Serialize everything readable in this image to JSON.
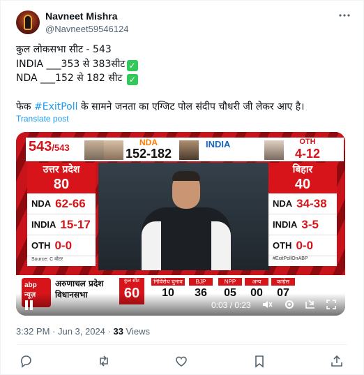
{
  "author": {
    "name": "Navneet Mishra",
    "handle": "@Navneet59546124"
  },
  "tweet": {
    "lines": [
      "कुल लोकसभा सीट - 543",
      "INDIA ___353 से 383सीट",
      "NDA ___152 से 182 सीट"
    ],
    "body_prefix": "फेक ",
    "hashtag": "#ExitPoll",
    "body_suffix": " के सामने जनता का एग्जिट पोल संदीप चौधरी जी लेकर आए है।",
    "check_symbol": "✓",
    "translate_label": "Translate post"
  },
  "video": {
    "seat_total": "543",
    "seat_total_suffix": "/543",
    "nda_label": "NDA",
    "nda_range": "152-182",
    "india_label": "INDIA",
    "oth_label": "OTH",
    "oth_range": "4-12",
    "left_state": {
      "name": "उत्तर प्रदेश",
      "seats": "80",
      "rows": [
        {
          "party": "NDA",
          "value": "62-66"
        },
        {
          "party": "INDIA",
          "value": "15-17"
        },
        {
          "party": "OTH",
          "value": "0-0"
        }
      ],
      "source": "Source: C वोटर"
    },
    "right_state": {
      "name": "बिहार",
      "seats": "40",
      "rows": [
        {
          "party": "NDA",
          "value": "34-38"
        },
        {
          "party": "INDIA",
          "value": "3-5"
        },
        {
          "party": "OTH",
          "value": "0-0"
        }
      ],
      "source": "#ExitPollOnABP"
    },
    "channel_logo_text": "abp न्यूज़",
    "bottom_title_line1": "अरुणाचल प्रदेश",
    "bottom_title_line2": "विधानसभा",
    "bottom_total_label": "कुल सीट",
    "bottom_total": "60",
    "bottom_cells": [
      {
        "label": "निर्विरोध चुनाव",
        "value": "10"
      },
      {
        "label": "BJP",
        "value": "36"
      },
      {
        "label": "NPP",
        "value": "05"
      },
      {
        "label": "अन्य",
        "value": "00"
      },
      {
        "label": "कांग्रेस",
        "value": "07"
      }
    ],
    "time": "0:03 / 0:23"
  },
  "meta": {
    "datetime": "3:32 PM · Jun 3, 2024 · ",
    "views_count": "33",
    "views_label": " Views"
  },
  "colors": {
    "link": "#1d9bf0",
    "muted": "#536471",
    "news_red": "#d7141a"
  },
  "icons": [
    "more-icon",
    "check-icon",
    "play-pause-icon",
    "mute-icon",
    "settings-icon",
    "fullscreen-icon",
    "reply-icon",
    "retweet-icon",
    "like-icon",
    "bookmark-icon",
    "share-icon"
  ]
}
